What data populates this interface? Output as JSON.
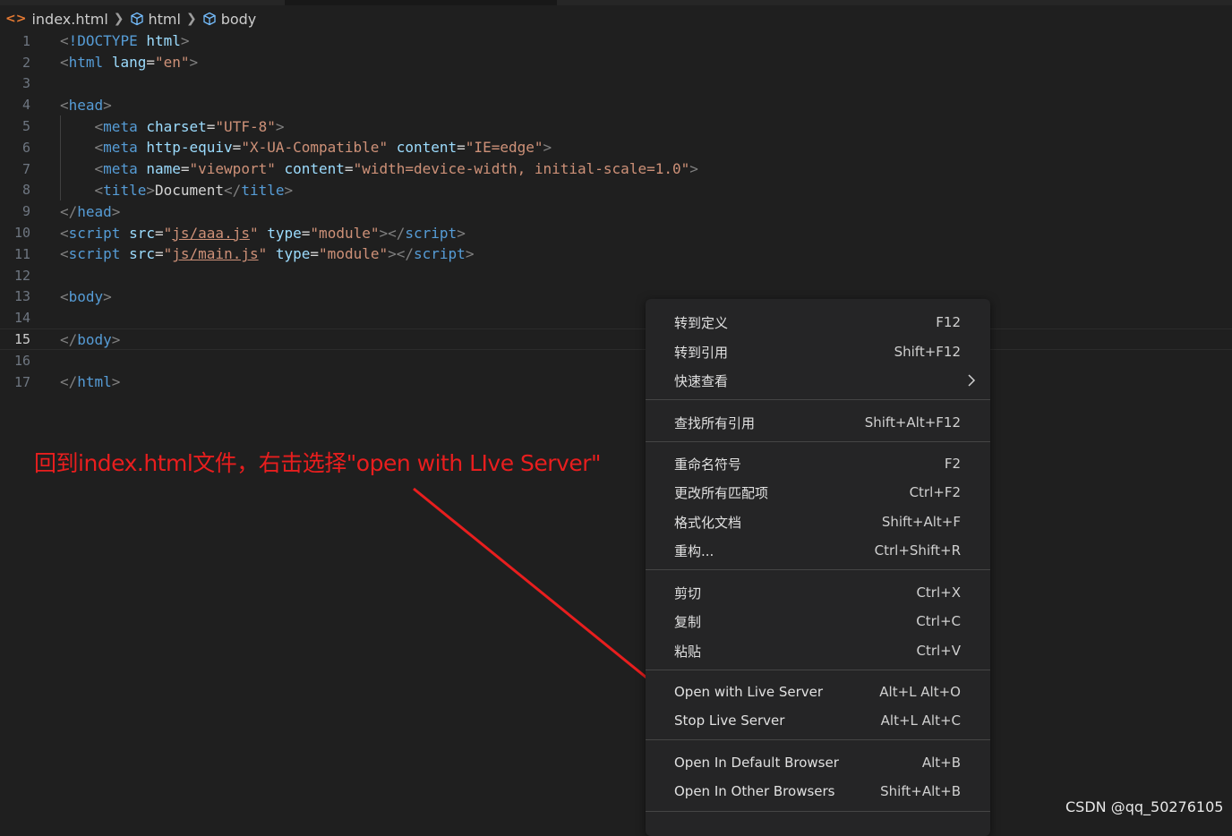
{
  "breadcrumb": {
    "file": "index.html",
    "items": [
      "html",
      "body"
    ]
  },
  "editor": {
    "lines": [
      {
        "n": "1"
      },
      {
        "n": "2"
      },
      {
        "n": "3"
      },
      {
        "n": "4"
      },
      {
        "n": "5"
      },
      {
        "n": "6"
      },
      {
        "n": "7"
      },
      {
        "n": "8"
      },
      {
        "n": "9"
      },
      {
        "n": "10"
      },
      {
        "n": "11"
      },
      {
        "n": "12"
      },
      {
        "n": "13"
      },
      {
        "n": "14"
      },
      {
        "n": "15"
      },
      {
        "n": "16"
      },
      {
        "n": "17"
      }
    ],
    "current_line": "15",
    "code": {
      "doctype": "!DOCTYPE",
      "doctype_html": "html",
      "html_tag": "html",
      "lang_attr": "lang",
      "lang_val": "\"en\"",
      "head_tag": "head",
      "meta_tag": "meta",
      "charset_attr": "charset",
      "charset_val": "\"UTF-8\"",
      "httpequiv_attr": "http-equiv",
      "httpequiv_val": "\"X-UA-Compatible\"",
      "content_attr": "content",
      "content_val_edge": "\"IE=edge\"",
      "name_attr": "name",
      "name_val": "\"viewport\"",
      "content_val_viewport": "\"width=device-width, initial-scale=1.0\"",
      "title_tag": "title",
      "title_text": "Document",
      "script_tag": "script",
      "src_attr": "src",
      "type_attr": "type",
      "type_val": "\"module\"",
      "src1": "js/aaa.js",
      "src2": "js/main.js",
      "quote": "\"",
      "body_tag": "body"
    }
  },
  "annotation": {
    "text": "回到index.html文件，右击选择\"open with LIve Server\""
  },
  "context_menu": {
    "items": [
      {
        "label": "转到定义",
        "key": "F12"
      },
      {
        "label": "转到引用",
        "key": "Shift+F12"
      },
      {
        "label": "快速查看",
        "key": ""
      },
      {
        "label": "查找所有引用",
        "key": "Shift+Alt+F12"
      },
      {
        "label": "重命名符号",
        "key": "F2"
      },
      {
        "label": "更改所有匹配项",
        "key": "Ctrl+F2"
      },
      {
        "label": "格式化文档",
        "key": "Shift+Alt+F"
      },
      {
        "label": "重构...",
        "key": "Ctrl+Shift+R"
      },
      {
        "label": "剪切",
        "key": "Ctrl+X"
      },
      {
        "label": "复制",
        "key": "Ctrl+C"
      },
      {
        "label": "粘贴",
        "key": "Ctrl+V"
      },
      {
        "label": "Open with Live Server",
        "key": "Alt+L Alt+O"
      },
      {
        "label": "Stop Live Server",
        "key": "Alt+L Alt+C"
      },
      {
        "label": "Open In Default Browser",
        "key": "Alt+B"
      },
      {
        "label": "Open In Other Browsers",
        "key": "Shift+Alt+B"
      }
    ]
  },
  "watermark": "CSDN @qq_50276105",
  "colors": {
    "background": "#1f1f1f",
    "menu_bg": "#252526",
    "annotation": "#e81e1e",
    "tag": "#569cd6",
    "attr": "#9cdcfe",
    "string": "#ce9178"
  }
}
